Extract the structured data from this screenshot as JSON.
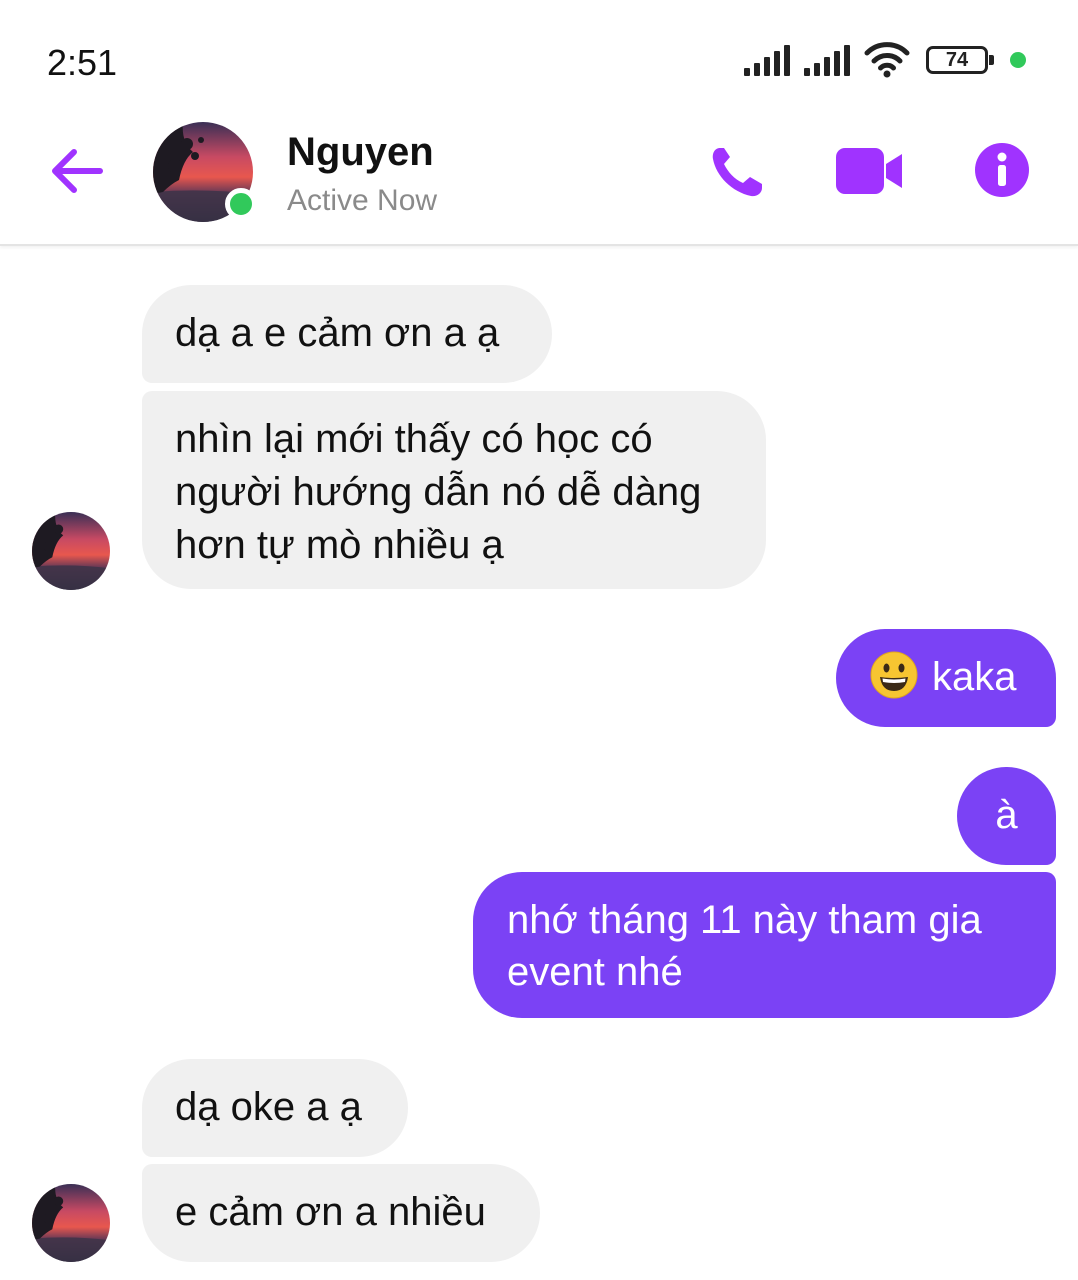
{
  "status_bar": {
    "time": "2:51",
    "battery": "74",
    "icons": [
      "signal-icon",
      "signal-icon",
      "wifi-icon",
      "battery-icon",
      "notification-dot"
    ]
  },
  "header": {
    "contact_name": "Nguyen",
    "contact_status": "Active Now",
    "icons": [
      "back-arrow-icon",
      "phone-icon",
      "video-camera-icon",
      "info-icon"
    ]
  },
  "colors": {
    "accent": "#7b42f5",
    "icon_purple": "#a033ff",
    "online": "#31c95b",
    "incoming_bubble": "#f0f0f0"
  },
  "messages": [
    {
      "direction": "incoming",
      "text": "dạ a e cảm ơn a ạ"
    },
    {
      "direction": "incoming",
      "lines": [
        "nhìn lại mới thấy có học có",
        "người hướng dẫn nó dễ dàng",
        "hơn tự mò nhiều ạ"
      ]
    },
    {
      "direction": "outgoing",
      "emoji": "grinning-face-emoji",
      "text": "kaka"
    },
    {
      "direction": "outgoing",
      "text": "à"
    },
    {
      "direction": "outgoing",
      "lines": [
        "nhớ tháng 11 này tham gia",
        "event nhé"
      ]
    },
    {
      "direction": "incoming",
      "text": "dạ oke a ạ"
    },
    {
      "direction": "incoming",
      "text": "e cảm ơn a nhiều"
    }
  ]
}
